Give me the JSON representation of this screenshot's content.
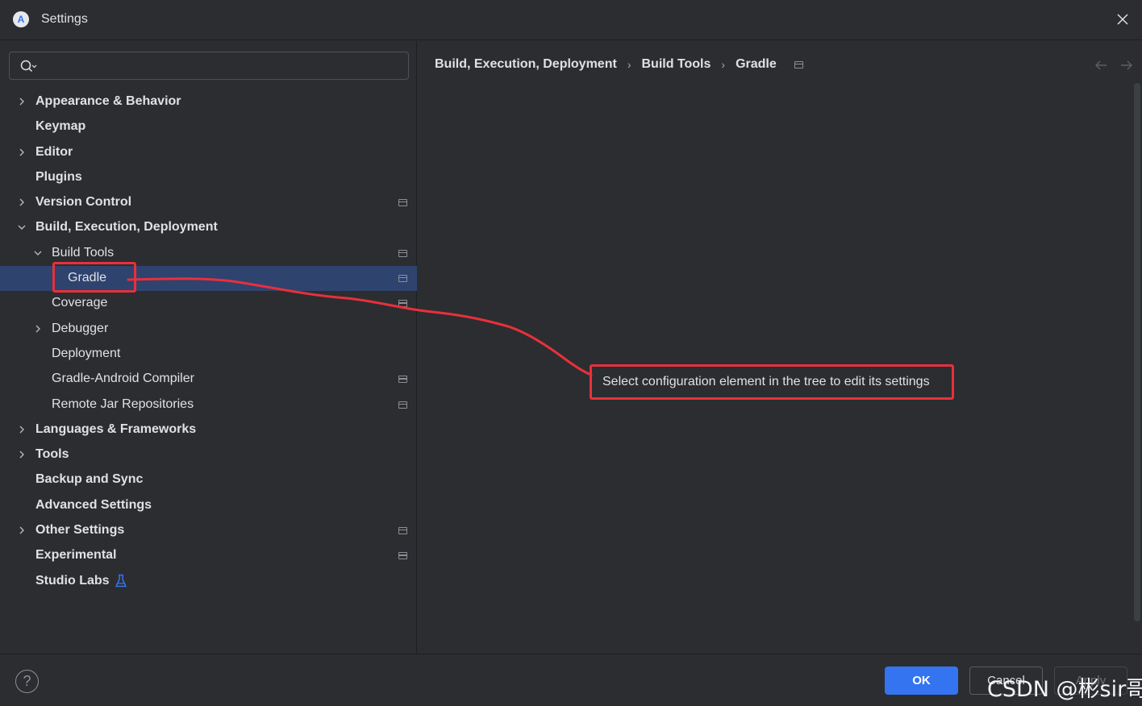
{
  "window": {
    "title": "Settings",
    "app_icon": "android-studio-icon",
    "app_icon_glyph": "A"
  },
  "search": {
    "value": "",
    "placeholder": ""
  },
  "tree": [
    {
      "label": "Appearance & Behavior",
      "bold": true,
      "expandable": true,
      "expanded": false
    },
    {
      "label": "Keymap",
      "bold": true
    },
    {
      "label": "Editor",
      "bold": true,
      "expandable": true,
      "expanded": false
    },
    {
      "label": "Plugins",
      "bold": true
    },
    {
      "label": "Version Control",
      "bold": true,
      "expandable": true,
      "expanded": false,
      "project_icon": true
    },
    {
      "label": "Build, Execution, Deployment",
      "bold": true,
      "expandable": true,
      "expanded": true
    },
    {
      "label": "Build Tools",
      "bold": false,
      "expandable": true,
      "expanded": true,
      "project_icon": true
    },
    {
      "label": "Gradle",
      "bold": false,
      "selected": true,
      "project_icon": true
    },
    {
      "label": "Coverage",
      "bold": false,
      "project_icon": true
    },
    {
      "label": "Debugger",
      "bold": false,
      "expandable": true,
      "expanded": false
    },
    {
      "label": "Deployment",
      "bold": false
    },
    {
      "label": "Gradle-Android Compiler",
      "bold": false,
      "project_icon": true
    },
    {
      "label": "Remote Jar Repositories",
      "bold": false,
      "project_icon": true
    },
    {
      "label": "Languages & Frameworks",
      "bold": true,
      "expandable": true,
      "expanded": false
    },
    {
      "label": "Tools",
      "bold": true,
      "expandable": true,
      "expanded": false
    },
    {
      "label": "Backup and Sync",
      "bold": true
    },
    {
      "label": "Advanced Settings",
      "bold": true
    },
    {
      "label": "Other Settings",
      "bold": true,
      "expandable": true,
      "expanded": false,
      "project_icon": true
    },
    {
      "label": "Experimental",
      "bold": true,
      "project_icon": true
    },
    {
      "label": "Studio Labs",
      "bold": true,
      "badge": "flask-icon"
    }
  ],
  "breadcrumb": [
    "Build, Execution, Deployment",
    "Build Tools",
    "Gradle"
  ],
  "breadcrumb_separator": "›",
  "content": {
    "hint": "Select configuration element in the tree to edit its settings"
  },
  "footer": {
    "help_label": "?",
    "ok_label": "OK",
    "cancel_label": "Cancel",
    "apply_label": "Apply",
    "watermark": "CSDN @彬sir哥"
  },
  "colors": {
    "background": "#2b2d30",
    "selection": "#2e436e",
    "accent": "#3574f0",
    "annotation": "#e8303c",
    "text": "#dfe1e5"
  }
}
